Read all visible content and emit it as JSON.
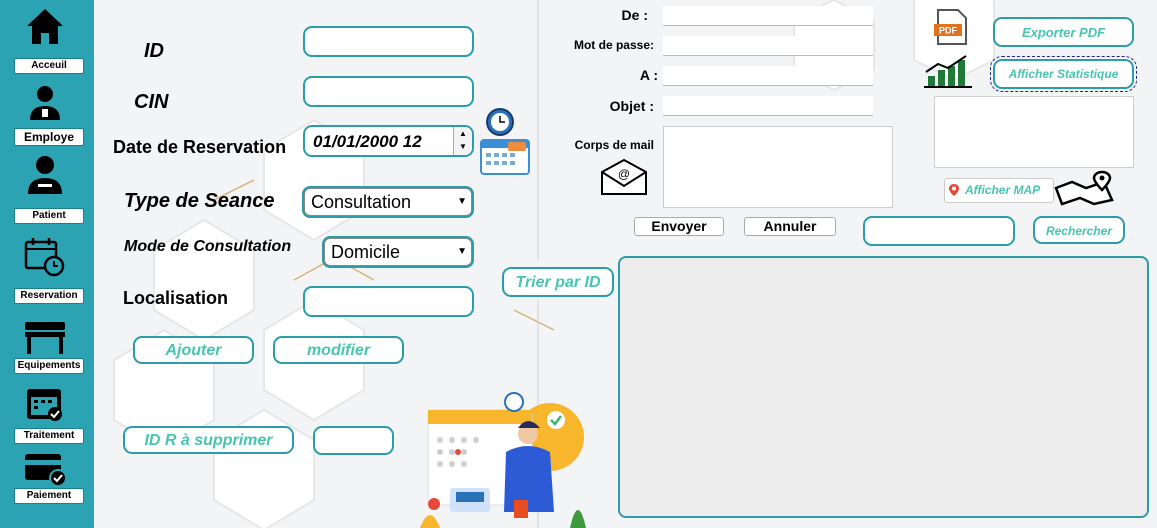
{
  "sidebar": {
    "items": [
      {
        "label": "Acceuil",
        "icon": "home-icon"
      },
      {
        "label": "Employe",
        "icon": "employee-icon"
      },
      {
        "label": "Patient",
        "icon": "patient-icon"
      },
      {
        "label": "Reservation",
        "icon": "calendar-clock-icon"
      },
      {
        "label": "Equipements",
        "icon": "bed-icon"
      },
      {
        "label": "Traitement",
        "icon": "calendar-check-icon"
      },
      {
        "label": "Paiement",
        "icon": "credit-card-icon"
      }
    ]
  },
  "form": {
    "id_label": "ID",
    "cin_label": "CIN",
    "date_label": "Date de Reservation",
    "date_value": "01/01/2000 12",
    "type_label": "Type de Seance",
    "type_value": "Consultation",
    "mode_label": "Mode de Consultation",
    "mode_value": "Domicile",
    "loc_label": "Localisation",
    "add_button": "Ajouter",
    "modify_button": "modifier",
    "delete_button": "ID  R à supprimer"
  },
  "mail": {
    "from_label": "De  :",
    "password_label": "Mot de passe:",
    "to_label": "A  :",
    "subject_label": "Objet :",
    "body_label": "Corps de mail",
    "send_button": "Envoyer",
    "cancel_button": "Annuler"
  },
  "actions": {
    "export_pdf": "Exporter  PDF",
    "show_stats": "Afficher Statistique",
    "show_map": "Afficher MAP",
    "search": "Rechercher",
    "sort_by_id": "Trier par ID",
    "pdf_icon_text": "PDF"
  },
  "colors": {
    "sidebar": "#2ba3b3",
    "accent": "#2a9da9",
    "button_text": "#48c5b0"
  }
}
